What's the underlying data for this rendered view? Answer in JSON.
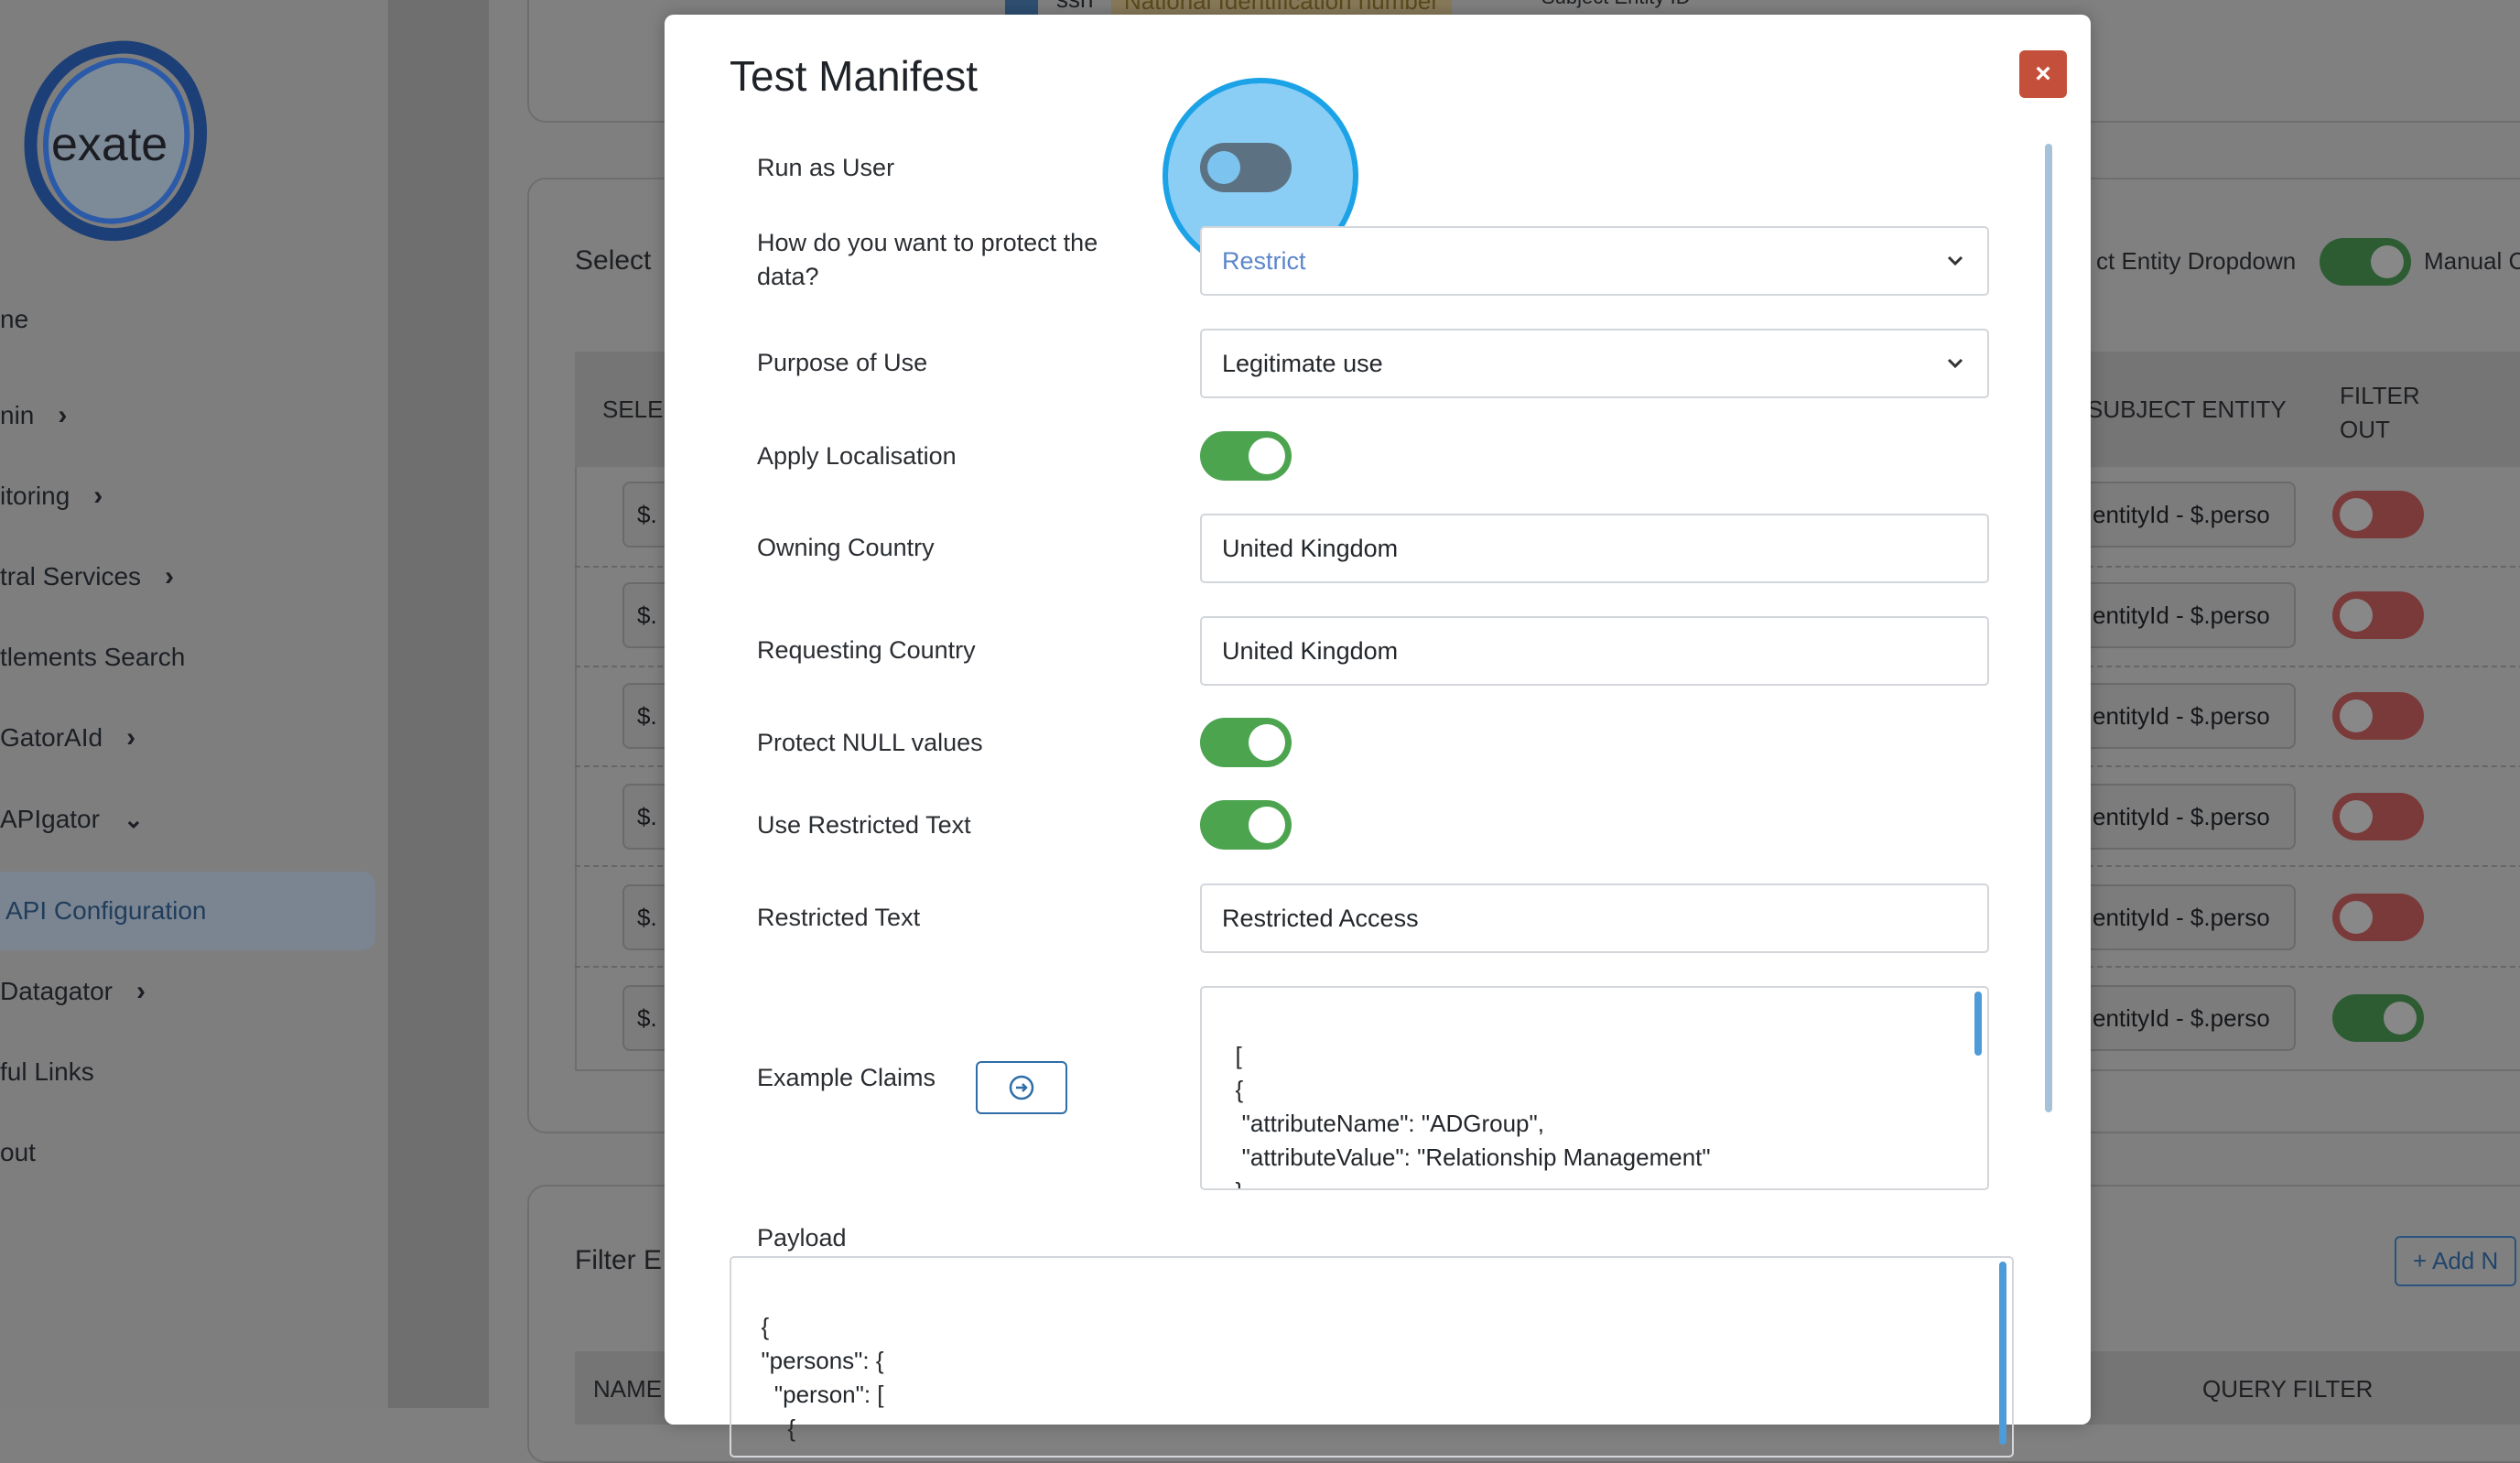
{
  "sidebar": {
    "logo_text": "exate",
    "items": [
      {
        "label": "ne",
        "chevron": false
      },
      {
        "label": "nin",
        "chevron": "right"
      },
      {
        "label": "itoring",
        "chevron": "right"
      },
      {
        "label": "tral Services",
        "chevron": "right"
      },
      {
        "label": "tlements Search",
        "chevron": false
      },
      {
        "label": "GatorAId",
        "chevron": "right"
      },
      {
        "label": "APIgator",
        "chevron": "down"
      },
      {
        "label": "API Configuration",
        "active": true
      },
      {
        "label": "Datagator",
        "chevron": "right"
      },
      {
        "label": "ful Links",
        "chevron": false
      },
      {
        "label": "out",
        "chevron": false
      }
    ]
  },
  "background": {
    "top_row": {
      "field": "ssn",
      "description": "National Identification number",
      "subject_label": "Subject Entity ID"
    },
    "select_section_title": "Select",
    "entity_dropdown_label": "ct Entity Dropdown",
    "manual_label": "Manual C",
    "col_select": "SELE",
    "col_subject_entity": "SUBJECT ENTITY",
    "col_filter_out": "FILTER OUT",
    "row_prefix": "$.",
    "row_subject_value": "entityId - $.perso",
    "filter_section_title": "Filter E",
    "add_button": "+ Add N",
    "col_name": "NAME",
    "col_query_filter": "QUERY FILTER"
  },
  "modal": {
    "title": "Test Manifest",
    "close_label": "×",
    "run_as_user_label": "Run as User",
    "protect_label": "How do you want to protect the data?",
    "protect_value": "Restrict",
    "purpose_label": "Purpose of Use",
    "purpose_value": "Legitimate use",
    "apply_localisation_label": "Apply Localisation",
    "owning_country_label": "Owning Country",
    "owning_country_value": "United Kingdom",
    "requesting_country_label": "Requesting Country",
    "requesting_country_value": "United Kingdom",
    "protect_null_label": "Protect NULL values",
    "use_restricted_text_label": "Use Restricted Text",
    "restricted_text_label": "Restricted Text",
    "restricted_text_value": "Restricted Access",
    "example_claims_label": "Example Claims",
    "example_claims_value": "[\n  {\n   \"attributeName\": \"ADGroup\",\n   \"attributeValue\": \"Relationship Management\"\n  },\n  {",
    "payload_label": "Payload",
    "payload_value": "{\n  \"persons\": {\n    \"person\": [\n      {"
  }
}
